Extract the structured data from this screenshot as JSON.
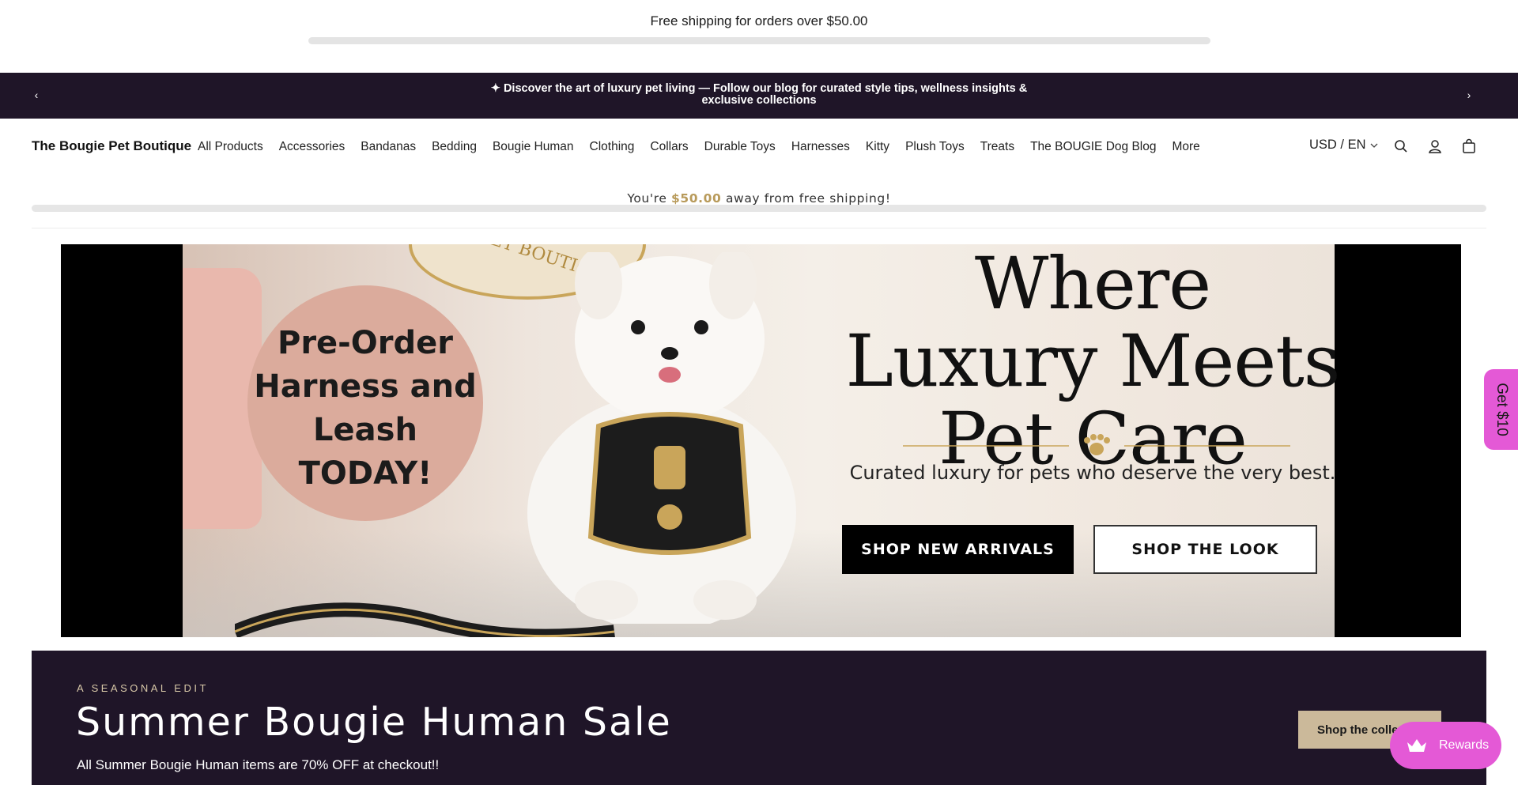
{
  "top_shipping": {
    "text": "Free shipping for orders over $50.00"
  },
  "announcement": {
    "text": "✦ Discover the art of luxury pet living — Follow our blog for curated style tips, wellness insights & exclusive collections",
    "prev_glyph": "‹",
    "next_glyph": "›"
  },
  "header": {
    "brand": "The Bougie Pet Boutique",
    "nav": [
      "All Products",
      "Accessories",
      "Bandanas",
      "Bedding",
      "Bougie Human",
      "Clothing",
      "Collars",
      "Durable Toys",
      "Harnesses",
      "Kitty",
      "Plush Toys",
      "Treats",
      "The BOUGIE Dog Blog",
      "More"
    ],
    "locale": "USD / EN",
    "icons": [
      "search-icon",
      "account-icon",
      "cart-icon"
    ]
  },
  "free_shipping_progress": {
    "prefix": "You're ",
    "amount": "$50.00",
    "suffix": " away from free shipping!",
    "progress": 0
  },
  "hero": {
    "seal_text": "ET BOUTIQU",
    "circle_text": "Pre-Order Harness and Leash TODAY!",
    "title": "Where Luxury Meets Pet Care",
    "subtitle": "Curated luxury for pets who deserve the very best.",
    "btn_arrivals": "SHOP NEW ARRIVALS",
    "btn_look": "SHOP THE LOOK"
  },
  "sale": {
    "eyebrow": "A SEASONAL EDIT",
    "title": "Summer Bougie Human Sale",
    "description": "All Summer Bougie Human items are 70% OFF at checkout!!",
    "button": "Shop the collec"
  },
  "widgets": {
    "get10": "Get $10",
    "rewards": "Rewards"
  },
  "colors": {
    "dark": "#1f1528",
    "gold": "#b89a5a",
    "pink": "#e459d6",
    "sale_button": "#cbb99a"
  }
}
